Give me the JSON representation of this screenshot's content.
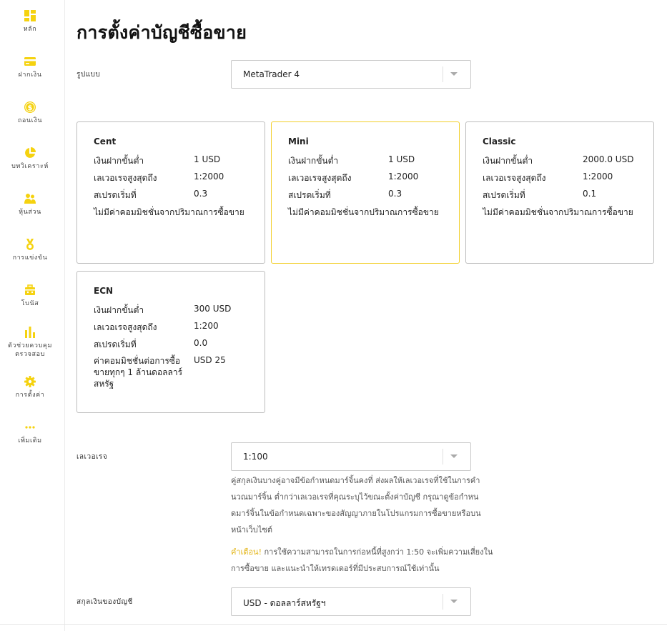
{
  "sidebar": {
    "items": [
      {
        "label": "หลัก",
        "icon": "dashboard-icon"
      },
      {
        "label": "ฝากเงิน",
        "icon": "credit-card-icon"
      },
      {
        "label": "ถอนเงิน",
        "icon": "dollar-coin-icon"
      },
      {
        "label": "บทวิเคราะห์",
        "icon": "pie-chart-icon"
      },
      {
        "label": "หุ้นส่วน",
        "icon": "partners-icon"
      },
      {
        "label": "การแข่งขัน",
        "icon": "medal-icon"
      },
      {
        "label": "โบนัส",
        "icon": "gift-icon"
      },
      {
        "label": "ตัวช่วยควบคุม",
        "label2": "ตรวจสอบ",
        "icon": "bar-chart-icon"
      },
      {
        "label": "การตั้งค่า",
        "icon": "gear-icon"
      },
      {
        "label": "เพิ่มเติม",
        "icon": "more-dots-icon"
      }
    ],
    "accent": "#f5d20f"
  },
  "page": {
    "title": "การตั้งค่าบัญชีซื้อขาย"
  },
  "platform": {
    "label": "รูปแบบ",
    "value": "MetaTrader 4"
  },
  "cards": [
    {
      "name": "Cent",
      "min_deposit_label": "เงินฝากขั้นต่ำ",
      "min_deposit": "1 USD",
      "leverage_label": "เลเวอเรจสูงสุดถึง",
      "leverage": "1:2000",
      "spread_label": "สเปรดเริ่มที่",
      "spread": "0.3",
      "note": "ไม่มีค่าคอมมิชชั่นจากปริมาณการซื้อขาย"
    },
    {
      "name": "Mini",
      "min_deposit_label": "เงินฝากขั้นต่ำ",
      "min_deposit": "1 USD",
      "leverage_label": "เลเวอเรจสูงสุดถึง",
      "leverage": "1:2000",
      "spread_label": "สเปรดเริ่มที่",
      "spread": "0.3",
      "note": "ไม่มีค่าคอมมิชชั่นจากปริมาณการซื้อขาย",
      "selected": true
    },
    {
      "name": "Classic",
      "min_deposit_label": "เงินฝากขั้นต่ำ",
      "min_deposit": "2000.0 USD",
      "leverage_label": "เลเวอเรจสูงสุดถึง",
      "leverage": "1:2000",
      "spread_label": "สเปรดเริ่มที่",
      "spread": "0.1",
      "note": "ไม่มีค่าคอมมิชชั่นจากปริมาณการซื้อขาย"
    },
    {
      "name": "ECN",
      "min_deposit_label": "เงินฝากขั้นต่ำ",
      "min_deposit": "300 USD",
      "leverage_label": "เลเวอเรจสูงสุดถึง",
      "leverage": "1:200",
      "spread_label": "สเปรดเริ่มที่",
      "spread": "0.0",
      "commission_label": "ค่าคอมมิชชั่นต่อการซื้อขายทุกๆ 1 ล้านดอลลาร์สหรัฐ",
      "commission": "USD 25"
    }
  ],
  "leverage": {
    "label": "เลเวอเรจ",
    "value": "1:100",
    "help": "คู่สกุลเงินบางคู่อาจมีข้อกำหนดมาร์จิ้นคงที่ ส่งผลให้เลเวอเรจที่ใช้ในการคำนวณมาร์จิ้น ต่ำกว่าเลเวอเรจที่คุณระบุไว้ขณะตั้งค่าบัญชี กรุณาดูข้อกำหนดมาร์จิ้นในข้อกำหนดเฉพาะของสัญญาภายในโปรแกรมการซื้อขายหรือบนหน้าเว็บไซต์",
    "warning_word": "คำเตือน!",
    "warning_text": " การใช้ความสามารถในการก่อหนี้ที่สูงกว่า 1:50 จะเพิ่มความเสี่ยงในการซื้อขาย และแนะนำให้เทรดเดอร์ที่มีประสบการณ์ใช้เท่านั้น"
  },
  "currency": {
    "label": "สกุลเงินของบัญชี",
    "value": "USD - ดอลลาร์สหรัฐฯ"
  }
}
